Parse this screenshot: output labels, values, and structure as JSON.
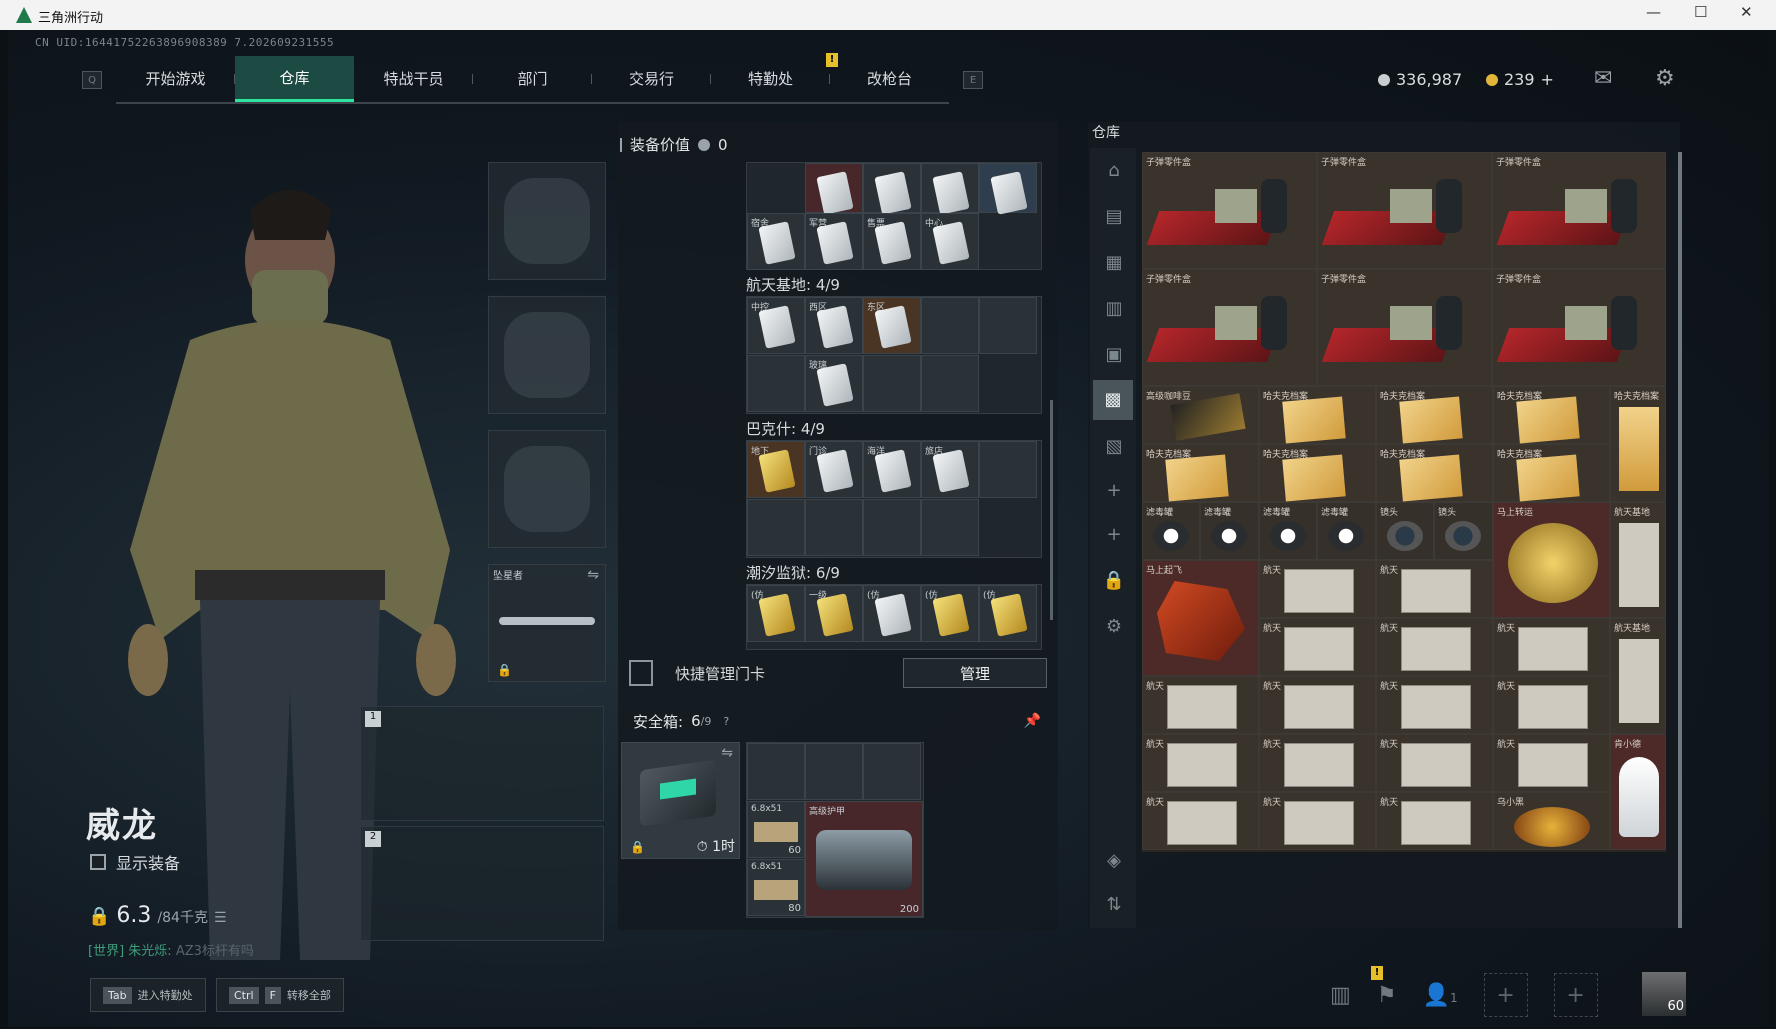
{
  "window": {
    "title": "三角洲行动",
    "min": "—",
    "max": "☐",
    "close": "✕"
  },
  "uid": "CN UID:16441752263896908389 7.202609231555",
  "nav": {
    "left_key": "Q",
    "right_key": "E",
    "tabs": [
      "开始游戏",
      "仓库",
      "特战干员",
      "部门",
      "交易行",
      "特勤处",
      "改枪台"
    ],
    "active": "仓库",
    "badge": "!"
  },
  "currency": {
    "silver": "336,987",
    "gold": "239",
    "plus": "+"
  },
  "character": {
    "name": "威龙",
    "show_equipment": "显示装备",
    "weight": "6.3",
    "weight_max": "/84千克",
    "chat_channel": "[世界]",
    "chat_user": "朱光烁:",
    "chat_msg": "AZ3标杆有吗"
  },
  "hotkeys": [
    {
      "keys": [
        "Tab"
      ],
      "label": "进入特勤处"
    },
    {
      "keys": [
        "Ctrl",
        "F"
      ],
      "label": "转移全部"
    }
  ],
  "gear_slots": {
    "melee_label": "坠星者",
    "weapon_slot_1": "1",
    "weapon_slot_2": "2"
  },
  "loadout": {
    "title": "装备价值",
    "value": "0"
  },
  "keycards": {
    "top_labels": [
      "宿舍",
      "军营",
      "售票",
      "中心"
    ],
    "section_1": {
      "title": "航天基地: 4/9",
      "labels": [
        "中控",
        "西区",
        "东区",
        "",
        "玻璃"
      ]
    },
    "section_2": {
      "title": "巴克什: 4/9",
      "labels": [
        "地下",
        "门诊",
        "海洋",
        "旅店"
      ]
    },
    "section_3": {
      "title": "潮汐监狱: 6/9",
      "labels": [
        "(仿",
        "一级",
        "(仿",
        "(仿",
        "(仿"
      ]
    }
  },
  "quick_manage": {
    "label": "快捷管理门卡",
    "button": "管理"
  },
  "safebox": {
    "title": "安全箱:",
    "count": "6",
    "cap": "/9",
    "timer": "1时",
    "ammo1": "6.8x51",
    "ammo1_count": "60",
    "ammo2": "6.8x51",
    "ammo2_count": "80",
    "armor": "高级护甲",
    "armor_value": "200"
  },
  "warehouse": {
    "title": "仓库",
    "ammo_parts": "子弹零件盒",
    "items_row3": [
      "高级咖啡豆",
      "哈夫克档案",
      "哈夫克档案",
      "哈夫克档案",
      "哈夫克档案"
    ],
    "items_row4": [
      "哈夫克档案",
      "哈夫克档案",
      "哈夫克档案",
      "哈夫克档案"
    ],
    "items_row5": [
      "滤毒罐",
      "滤毒罐",
      "滤毒罐",
      "滤毒罐",
      "镜头",
      "镜头",
      "马上转运",
      "航天基地"
    ],
    "items_row6": [
      "马上起飞",
      "航天",
      "航天"
    ],
    "items_row7": [
      "航天",
      "航天",
      "航天",
      "航天基地"
    ],
    "items_row8": [
      "航天",
      "航天",
      "航天",
      "航天"
    ],
    "items_row9": [
      "航天",
      "航天",
      "航天",
      "航天",
      "肯小德"
    ],
    "items_row10": [
      "航天",
      "航天",
      "航天",
      "乌小黑"
    ]
  },
  "bottom": {
    "people": "1",
    "avatar_level": "60"
  }
}
